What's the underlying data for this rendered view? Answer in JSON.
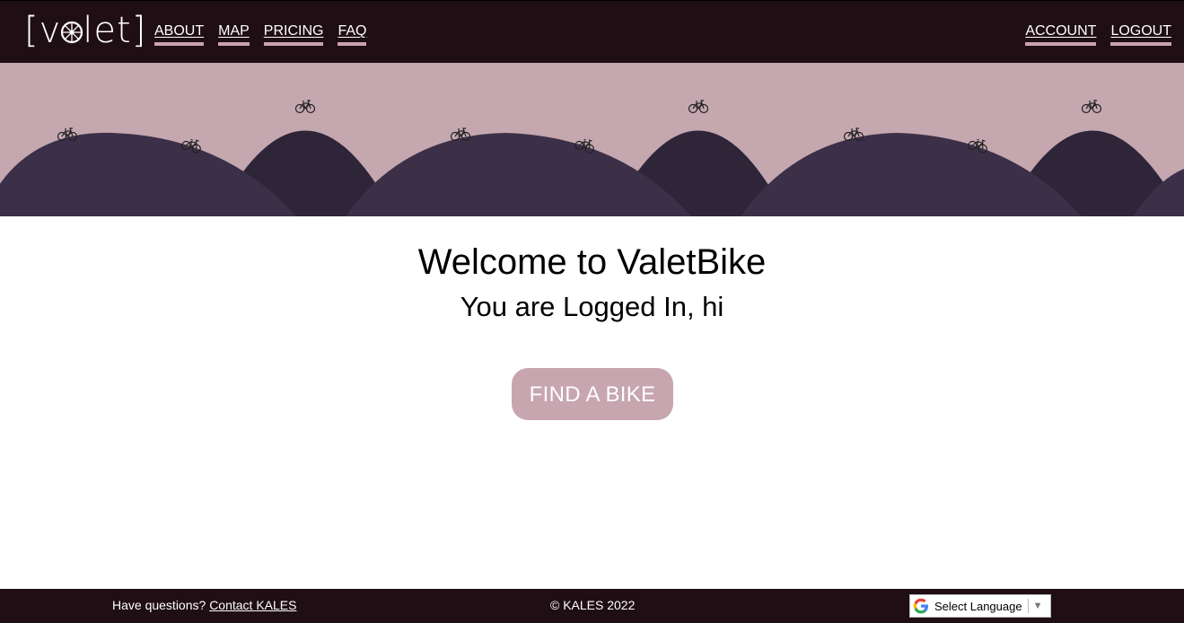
{
  "brand": {
    "logo_left": "[v",
    "logo_right": "let]"
  },
  "nav": {
    "left": [
      "ABOUT",
      "MAP",
      "PRICING",
      "FAQ"
    ],
    "right": [
      "ACCOUNT",
      "LOGOUT"
    ]
  },
  "main": {
    "welcome": "Welcome to ValetBike",
    "subtitle": "You are Logged In, hi",
    "find_button": "FIND A BIKE"
  },
  "footer": {
    "question": "Have questions?",
    "contact_link": "Contact KALES",
    "copyright": "© KALES 2022",
    "language_select": "Select Language",
    "language_arrow": "▼"
  },
  "colors": {
    "navbar": "#1f0e14",
    "hero_sky": "#c5a7b0",
    "hill_front": "#3b3048",
    "hill_back": "#2e2538",
    "accent": "#c7a6b0"
  }
}
